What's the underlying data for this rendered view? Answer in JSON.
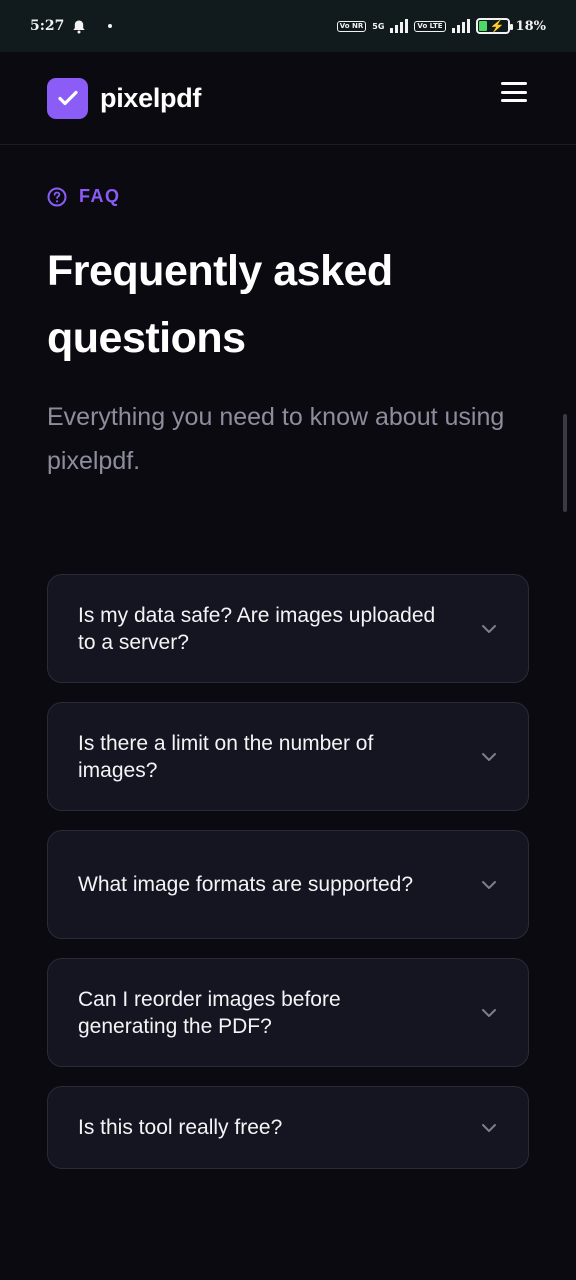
{
  "status_bar": {
    "time": "5:27",
    "sim1_badge": "Vo NR",
    "sim1_network": "5G",
    "sim2_badge": "Vo LTE",
    "battery_percent": "18%",
    "battery_level": 0.18,
    "icons": [
      "bell-icon",
      "signal-icon",
      "battery-charging-icon"
    ]
  },
  "header": {
    "brand_name": "pixelpdf",
    "logo_icon": "check-icon",
    "menu_icon": "hamburger-menu-icon",
    "colors": {
      "logo_bg": "#8b5cf6",
      "background": "#0a0a10"
    }
  },
  "hero": {
    "eyebrow": "FAQ",
    "eyebrow_icon": "question-circle-icon",
    "title_line1": "Frequently asked",
    "title_line2": "questions",
    "subtitle": "Everything you need to know about using pixelpdf.",
    "accent_color": "#8b5cf6"
  },
  "faq": {
    "items": [
      {
        "question": "Is my data safe? Are images uploaded to a server?",
        "expanded": false
      },
      {
        "question": "Is there a limit on the number of images?",
        "expanded": false
      },
      {
        "question": "What image formats are supported?",
        "expanded": false
      },
      {
        "question": "Can I reorder images before generating the PDF?",
        "expanded": false
      },
      {
        "question": "Is this tool really free?",
        "expanded": false
      }
    ],
    "toggle_icon": "chevron-down-icon"
  }
}
